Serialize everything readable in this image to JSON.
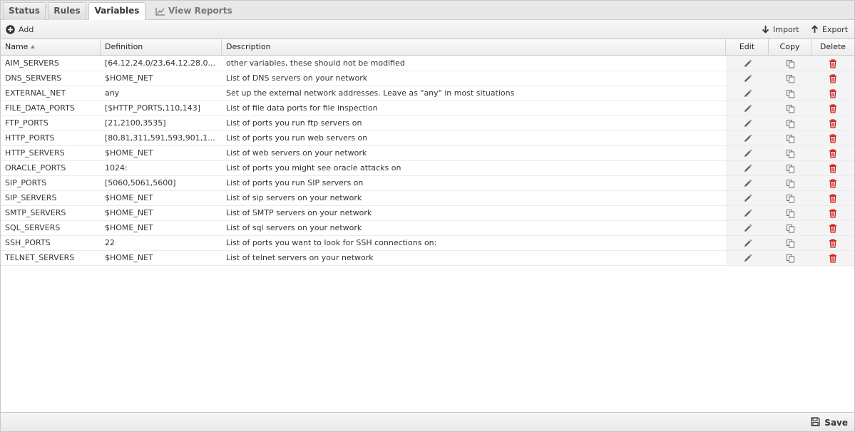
{
  "tabs": [
    {
      "label": "Status"
    },
    {
      "label": "Rules"
    },
    {
      "label": "Variables",
      "active": true
    },
    {
      "label": "View Reports",
      "icon": "line-chart-icon"
    }
  ],
  "toolbar": {
    "add_label": "Add",
    "import_label": "Import",
    "export_label": "Export"
  },
  "table": {
    "columns": {
      "name": "Name",
      "definition": "Definition",
      "description": "Description",
      "edit": "Edit",
      "copy": "Copy",
      "delete": "Delete"
    },
    "sort": {
      "column": "Name",
      "direction": "ascending"
    },
    "rows": [
      {
        "name": "AIM_SERVERS",
        "definition": "[64.12.24.0/23,64.12.28.0...",
        "description": "other variables, these should not be modified"
      },
      {
        "name": "DNS_SERVERS",
        "definition": "$HOME_NET",
        "description": "List of DNS servers on your network"
      },
      {
        "name": "EXTERNAL_NET",
        "definition": "any",
        "description": "Set up the external network addresses. Leave as \"any\" in most situations"
      },
      {
        "name": "FILE_DATA_PORTS",
        "definition": "[$HTTP_PORTS,110,143]",
        "description": "List of file data ports for file inspection"
      },
      {
        "name": "FTP_PORTS",
        "definition": "[21,2100,3535]",
        "description": "List of ports you run ftp servers on"
      },
      {
        "name": "HTTP_PORTS",
        "definition": "[80,81,311,591,593,901,1...",
        "description": "List of ports you run web servers on"
      },
      {
        "name": "HTTP_SERVERS",
        "definition": "$HOME_NET",
        "description": "List of web servers on your network"
      },
      {
        "name": "ORACLE_PORTS",
        "definition": "1024:",
        "description": "List of ports you might see oracle attacks on"
      },
      {
        "name": "SIP_PORTS",
        "definition": "[5060,5061,5600]",
        "description": "List of ports you run SIP servers on"
      },
      {
        "name": "SIP_SERVERS",
        "definition": "$HOME_NET",
        "description": "List of sip servers on your network"
      },
      {
        "name": "SMTP_SERVERS",
        "definition": "$HOME_NET",
        "description": "List of SMTP servers on your network"
      },
      {
        "name": "SQL_SERVERS",
        "definition": "$HOME_NET",
        "description": "List of sql servers on your network"
      },
      {
        "name": "SSH_PORTS",
        "definition": "22",
        "description": "List of ports you want to look for SSH connections on:"
      },
      {
        "name": "TELNET_SERVERS",
        "definition": "$HOME_NET",
        "description": "List of telnet servers on your network"
      }
    ]
  },
  "footer": {
    "save_label": "Save"
  },
  "icons": {
    "add": "plus-circle-icon",
    "import": "arrow-down-icon",
    "export": "arrow-up-icon",
    "edit": "pencil-icon",
    "copy": "copy-icon",
    "delete": "trash-icon",
    "save": "floppy-disk-icon"
  },
  "colors": {
    "delete_icon": "#cc2222",
    "action_icon": "#666666",
    "chrome": "#e8e8e8"
  }
}
